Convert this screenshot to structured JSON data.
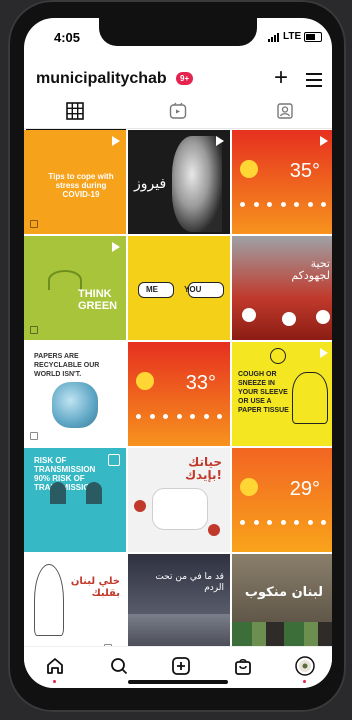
{
  "status": {
    "time": "4:05",
    "network": "LTE"
  },
  "profile": {
    "username": "municipalitychab",
    "notification_badge": "9+"
  },
  "tabs": [
    {
      "name": "grid-icon"
    },
    {
      "name": "reels-icon"
    },
    {
      "name": "tagged-icon"
    }
  ],
  "posts": [
    {
      "caption": "Tips to cope with stress during COVID-19",
      "bg": "#f7a21b"
    },
    {
      "caption": "فيروز",
      "bg": "#1b1b1b"
    },
    {
      "caption": "35°",
      "bg": "#f05a22"
    },
    {
      "caption": "THINK GREEN",
      "bg": "#a8c43a"
    },
    {
      "caption": "ME   YOU",
      "bg": "#f5d019"
    },
    {
      "caption": "تحية لجهودكم",
      "bg": "#c0392b"
    },
    {
      "caption": "PAPERS ARE RECYCLABLE OUR WORLD ISN'T.",
      "bg": "#ffffff"
    },
    {
      "caption": "33°",
      "bg": "#ef4a26"
    },
    {
      "caption": "COUGH OR SNEEZE IN YOUR SLEEVE OR USE A PAPER TISSUE",
      "bg": "#f4e620"
    },
    {
      "caption": "RISK OF TRANSMISSION 90% RISK OF TRANSMISSION",
      "bg": "#36b9c5"
    },
    {
      "caption": "حياتك بإيدك!",
      "bg": "#f2f2f2"
    },
    {
      "caption": "29°",
      "bg": "#f5802b"
    },
    {
      "caption": "خلي لبنان بقلبك",
      "bg": "#ffffff"
    },
    {
      "caption": "قد ما في من تحت الردم",
      "bg": "#3b3d4a"
    },
    {
      "caption": "لبنان منكوب",
      "bg": "#6a5f4f"
    }
  ],
  "bottom_nav": [
    {
      "name": "home-icon"
    },
    {
      "name": "search-icon"
    },
    {
      "name": "add-post-icon"
    },
    {
      "name": "shop-icon"
    },
    {
      "name": "profile-icon"
    }
  ],
  "colors": {
    "accent": "#e4234e"
  }
}
